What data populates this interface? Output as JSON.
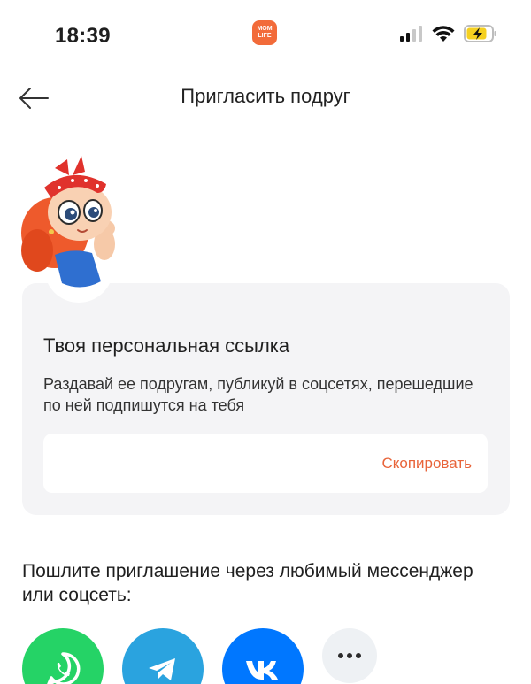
{
  "status_bar": {
    "time": "18:39",
    "app_badge": "MOM LIFE",
    "battery_color": "#f5d020"
  },
  "header": {
    "title": "Пригласить подруг",
    "back_icon": "arrow-left-icon"
  },
  "card": {
    "title": "Твоя персональная ссылка",
    "description": "Раздавай ее подругам, публикуй в соцсетях, перешедшие по ней подпишутся на тебя",
    "link_value": "",
    "copy_label": "Скопировать"
  },
  "share": {
    "prompt": "Пошлите приглашение через любимый мессенджер или соцсеть:",
    "buttons": [
      {
        "name": "whatsapp",
        "icon": "whatsapp-icon",
        "color": "#25d366"
      },
      {
        "name": "telegram",
        "icon": "telegram-icon",
        "color": "#2aa3df"
      },
      {
        "name": "vk",
        "icon": "vk-icon",
        "color": "#0077ff"
      },
      {
        "name": "more",
        "icon": "more-icon",
        "color": "#eef1f4"
      }
    ]
  },
  "colors": {
    "accent": "#e8643a",
    "card_bg": "#f4f4f6"
  }
}
